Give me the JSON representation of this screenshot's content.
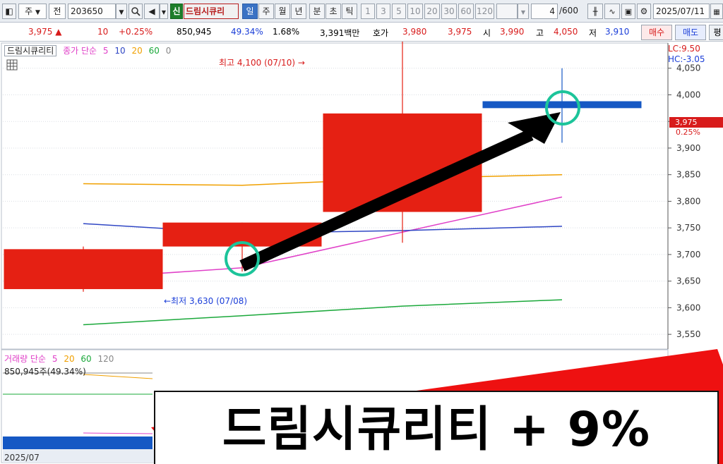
{
  "toolbar": {
    "market": "주",
    "prev_label": "전",
    "code": "203650",
    "badge": "신",
    "stock_name": "드림시큐리",
    "periods": [
      "일",
      "주",
      "월",
      "년",
      "분",
      "초",
      "틱"
    ],
    "selected_period": "일",
    "intervals": [
      "1",
      "3",
      "5",
      "10",
      "20",
      "30",
      "60",
      "120"
    ],
    "page_count": "4",
    "page_total": "/600",
    "date": "2025/07/11"
  },
  "quote": {
    "price": "3,975",
    "change": "10",
    "change_pct": "+0.25%",
    "volume": "850,945",
    "rate1": "49.34%",
    "rate2": "1.68%",
    "amount": "3,391백만",
    "ask_label": "호가",
    "ask1": "3,980",
    "ask2": "3,975",
    "open_label": "시",
    "open": "3,990",
    "high_label": "고",
    "high": "4,050",
    "low_label": "저",
    "low": "3,910",
    "buy_label": "매수",
    "sell_label": "매도",
    "extra_label": "평"
  },
  "chart": {
    "title": "드림시큐리티",
    "legend_prefix": "종가 단순",
    "ma": [
      {
        "label": "5",
        "color": "#e040c8"
      },
      {
        "label": "10",
        "color": "#2f46c4"
      },
      {
        "label": "20",
        "color": "#f0a000"
      },
      {
        "label": "60",
        "color": "#1aa83a"
      },
      {
        "label": "0",
        "color": "#888888"
      }
    ],
    "lc": "LC:9.50",
    "hc": "HC:-3.05",
    "high_annotation": "최고 4,100 (07/10) →",
    "low_annotation": "←최저 3,630 (07/08)",
    "current_price_tag": "3,975",
    "current_pct_tag": "0.25%",
    "volume_legend_prefix": "거래량 단순",
    "volume_ma": [
      {
        "label": "5",
        "color": "#e040c8"
      },
      {
        "label": "20",
        "color": "#f0a000"
      },
      {
        "label": "60",
        "color": "#1aa83a"
      },
      {
        "label": "120",
        "color": "#888888"
      }
    ],
    "volume_value": "850,945주(49.34%)",
    "date_label": "2025/07"
  },
  "chart_data": {
    "type": "candlestick",
    "y_ticks": [
      3550,
      3600,
      3650,
      3700,
      3750,
      3800,
      3850,
      3900,
      3950,
      4000,
      4050
    ],
    "ylim": [
      3525,
      4100
    ],
    "candles": [
      {
        "open": 3710,
        "close": 3635,
        "high": 3715,
        "low": 3630,
        "color": "#e52013"
      },
      {
        "open": 3715,
        "close": 3760,
        "high": 3760,
        "low": 3668,
        "color": "#e52013"
      },
      {
        "open": 3780,
        "close": 3965,
        "high": 4100,
        "low": 3722,
        "color": "#e52013"
      },
      {
        "open": 3988,
        "close": 3975,
        "high": 4050,
        "low": 3910,
        "color": "#1558c4"
      }
    ],
    "ma_lines": [
      {
        "name": "5",
        "color": "#e040c8",
        "values": [
          3655,
          3675,
          3742,
          3808
        ]
      },
      {
        "name": "10",
        "color": "#2f46c4",
        "values": [
          3758,
          3740,
          3745,
          3753
        ]
      },
      {
        "name": "20",
        "color": "#f0a000",
        "values": [
          3833,
          3830,
          3843,
          3850
        ]
      },
      {
        "name": "60",
        "color": "#1aa83a",
        "values": [
          3568,
          3585,
          3603,
          3615
        ]
      }
    ],
    "volume_ma_colors": [
      "#888888",
      "#f0a000",
      "#1aa83a",
      "#e040c8"
    ]
  },
  "banner": {
    "text": "드림시큐리티 + 9%"
  }
}
